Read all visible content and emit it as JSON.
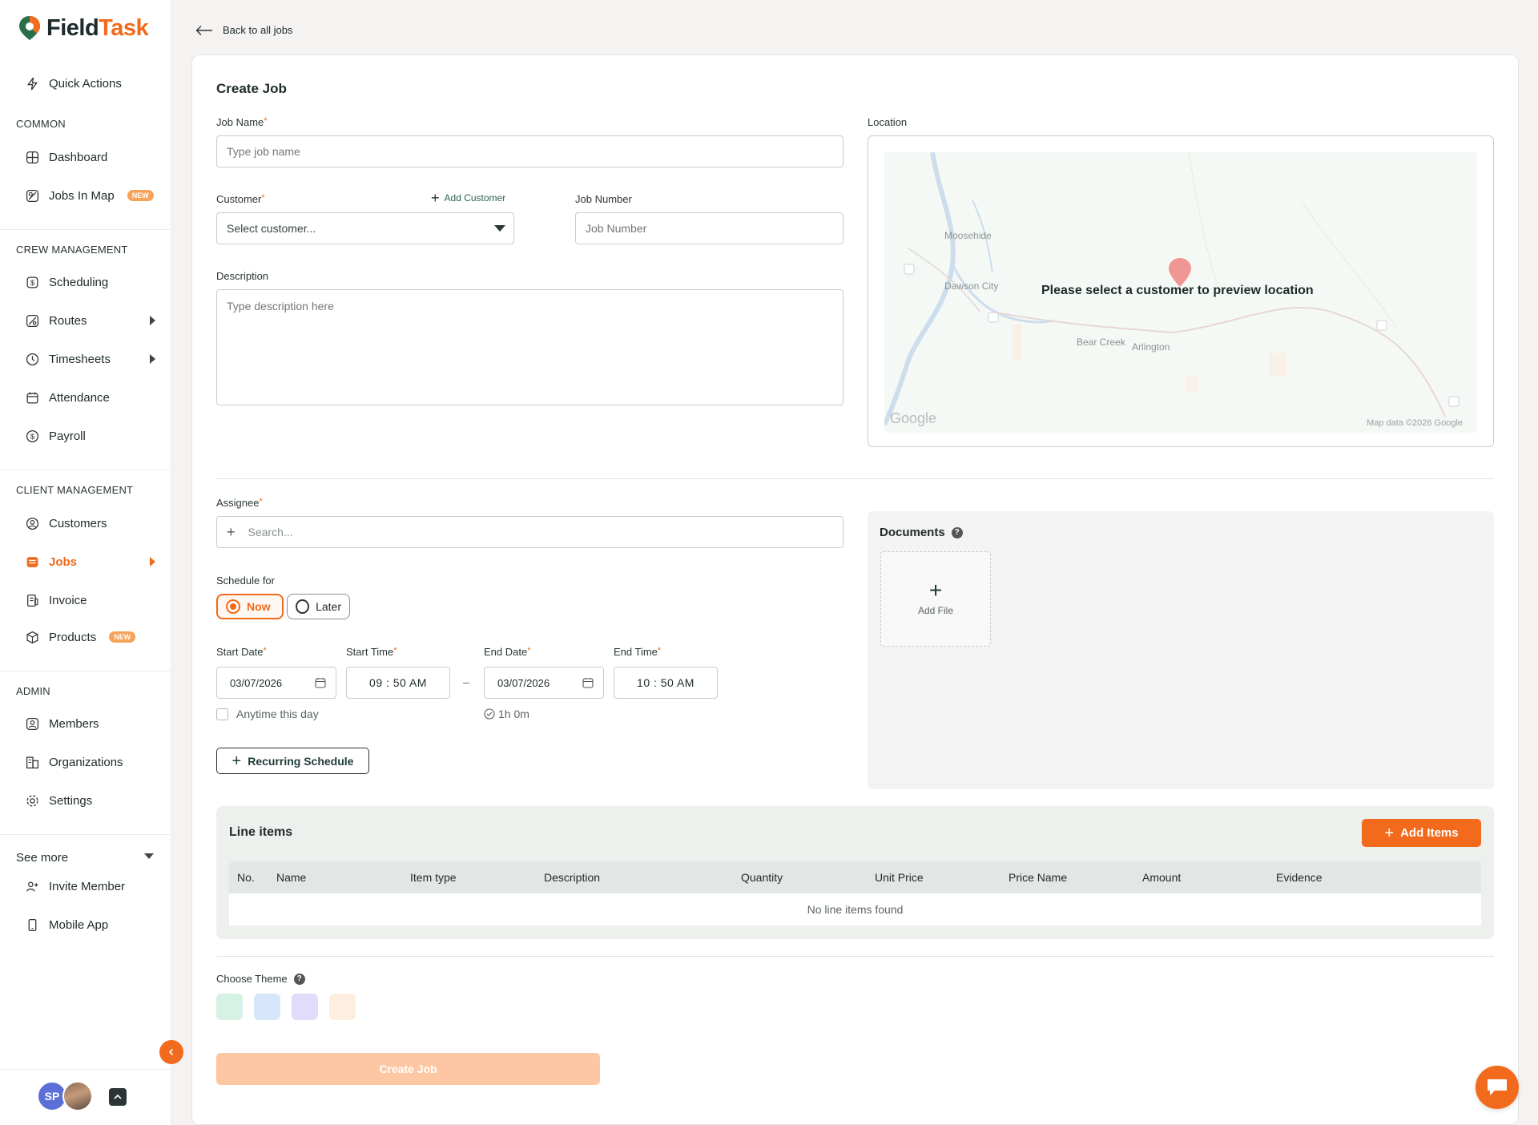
{
  "brand": {
    "name_part1": "Field",
    "name_part2": "Task",
    "accent_color": "#f26a1b"
  },
  "sidebar": {
    "quick_actions": "Quick Actions",
    "sections": {
      "common": "COMMON",
      "crew": "CREW MANAGEMENT",
      "client": "CLIENT MANAGEMENT",
      "admin": "ADMIN"
    },
    "items": {
      "dashboard": "Dashboard",
      "jobs_in_map": "Jobs In Map",
      "scheduling": "Scheduling",
      "routes": "Routes",
      "timesheets": "Timesheets",
      "attendance": "Attendance",
      "payroll": "Payroll",
      "customers": "Customers",
      "jobs": "Jobs",
      "invoice": "Invoice",
      "products": "Products",
      "members": "Members",
      "organizations": "Organizations",
      "settings": "Settings",
      "see_more": "See more",
      "invite_member": "Invite Member",
      "mobile_app": "Mobile App"
    },
    "badge_new": "NEW",
    "avatar_initials": "SP"
  },
  "header": {
    "back_link": "Back to all jobs"
  },
  "form": {
    "title": "Create Job",
    "job_name_label": "Job Name",
    "job_name_placeholder": "Type job name",
    "customer_label": "Customer",
    "customer_placeholder": "Select customer...",
    "add_customer": "Add Customer",
    "job_number_label": "Job Number",
    "job_number_placeholder": "Job Number",
    "description_label": "Description",
    "description_placeholder": "Type description here",
    "location_label": "Location",
    "map_message": "Please select a customer to preview location",
    "map_places": [
      "Moosehide",
      "Dawson City",
      "Bear Creek",
      "Arlington"
    ],
    "map_google": "Google",
    "map_data": "Map data ©2026 Google",
    "assignee_label": "Assignee",
    "assignee_placeholder": "Search...",
    "schedule_label": "Schedule for",
    "schedule_now": "Now",
    "schedule_later": "Later",
    "start_date_label": "Start Date",
    "start_date": "03/07/2026",
    "start_time_label": "Start Time",
    "start_time": "09 : 50  AM",
    "end_date_label": "End Date",
    "end_date": "03/07/2026",
    "end_time_label": "End Time",
    "end_time": "10  : 50  AM",
    "date_separator": "–",
    "anytime": "Anytime this day",
    "duration": "1h 0m",
    "recurring": "Recurring Schedule",
    "documents_title": "Documents",
    "add_file": "Add File",
    "line_items_title": "Line items",
    "add_items": "Add Items",
    "columns": [
      "No.",
      "Name",
      "Item type",
      "Description",
      "Quantity",
      "Unit Price",
      "Price Name",
      "Amount",
      "Evidence"
    ],
    "empty_line_items": "No line items found",
    "theme_label": "Choose Theme",
    "theme_colors": [
      "#d6f2e4",
      "#d6e6fb",
      "#e2dcfb",
      "#fdeee0"
    ],
    "create_button": "Create Job"
  }
}
